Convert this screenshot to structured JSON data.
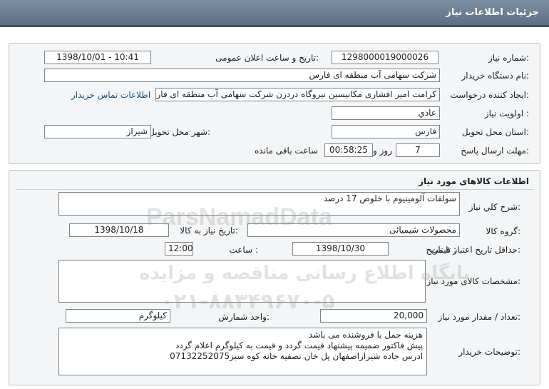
{
  "header": {
    "title": "جزئیات اطلاعات نیاز"
  },
  "info": {
    "need_number_label": "شماره نیاز:",
    "need_number": "1298000019000026",
    "announce_label": "تاریخ و ساعت اعلان عمومی:",
    "announce_value": "1398/10/01 - 10:41",
    "buyer_org_label": "نام دستگاه خریدار:",
    "buyer_org": "شرکت سهامی آب منطقه ای فارس",
    "creator_label": "ایجاد کننده درخواست:",
    "creator": "کرامت امیر افشاری مکانیسین نیروگاه دردزن شرکت سهامی آب منطقه ای فارس",
    "contact_link": "اطلاعات تماس خریدار",
    "priority_label": "اولویت نیاز :",
    "priority": "عادي",
    "province_label": "استان محل تحویل:",
    "province": "فارس",
    "city_label": "شهر محل تحویل:",
    "city": "شیراز",
    "deadline_label": "مهلت ارسال پاسخ:",
    "days": "7",
    "days_suffix": "روز و",
    "time_left": "00:58:25",
    "time_left_suffix": "ساعت باقی مانده"
  },
  "goods": {
    "section_title": "اطلاعات کالاهای مورد نیاز",
    "summary_label": "شرح کلي نیاز:",
    "summary": "سولفات آلومینیوم با خلوص 17 درصد",
    "group_label": "گروه کالا:",
    "group": "محصولات شیمیائی",
    "need_date_label": "تاریخ نیاز به کالا:",
    "need_date": "1398/10/18",
    "validity_label": "حداقل تاریخ اعتبار قیمت:",
    "until_date_label": "تا تاریخ :",
    "until_date": "1398/10/30",
    "hour_label": "ساعت :",
    "hour": "12:00",
    "spec_label": "مشخصات کالای مورد نیاز:",
    "qty_label": "تعداد / مقدار مورد نیاز:",
    "qty": "20,000",
    "unit_label": "واحد شمارش:",
    "unit": "کیلوگرم",
    "notes_label": "توضیحات خریدار:",
    "notes_line1": "هزینه حمل با فروشنده می باشد",
    "notes_line2": "پیش فاکتور ضمیمه پیشنهاد قیمت گردد و قیمت به کیلوگرم اعلام گردد",
    "notes_line3": "ادرس جاده شیرازاصفهان پل خان تصفیه خانه کوه سبز07132252075"
  },
  "watermark": {
    "line1": "ParsNamadData",
    "line2": "پایگاه اطلاع رسانی مناقصه و مزایده",
    "line3": "۰۲۱-۸۸۳۴۹۶۷۰-۵"
  }
}
